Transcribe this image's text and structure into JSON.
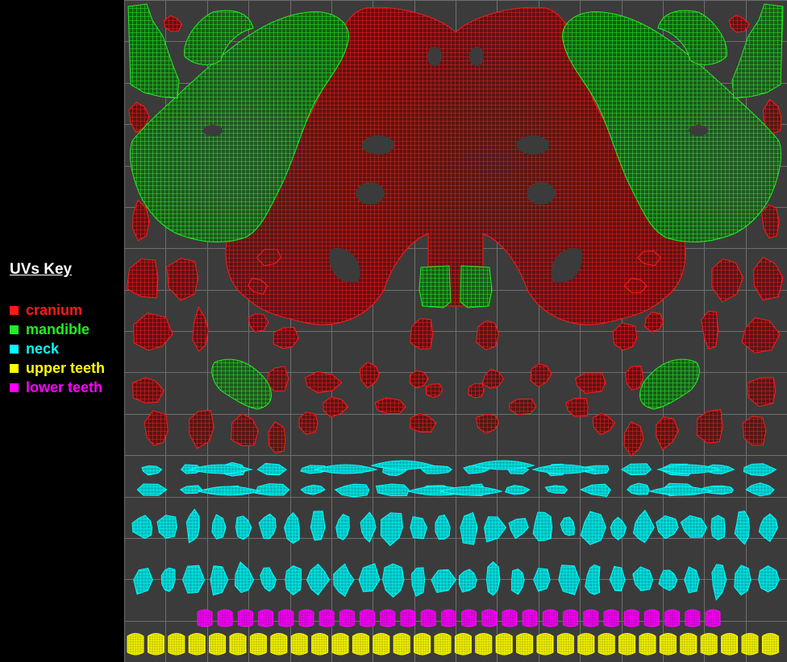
{
  "key": {
    "title": "UVs Key",
    "items": [
      {
        "label": "cranium",
        "color": "#ff1a1a"
      },
      {
        "label": "mandible",
        "color": "#22ee22"
      },
      {
        "label": "neck",
        "color": "#00ffff"
      },
      {
        "label": "upper teeth",
        "color": "#ffff00"
      },
      {
        "label": "lower teeth",
        "color": "#ff00ff"
      }
    ]
  },
  "uv_map": {
    "background": "#3b3b3b",
    "grid_color": "#6e6e6e",
    "grid_divisions": 16
  }
}
